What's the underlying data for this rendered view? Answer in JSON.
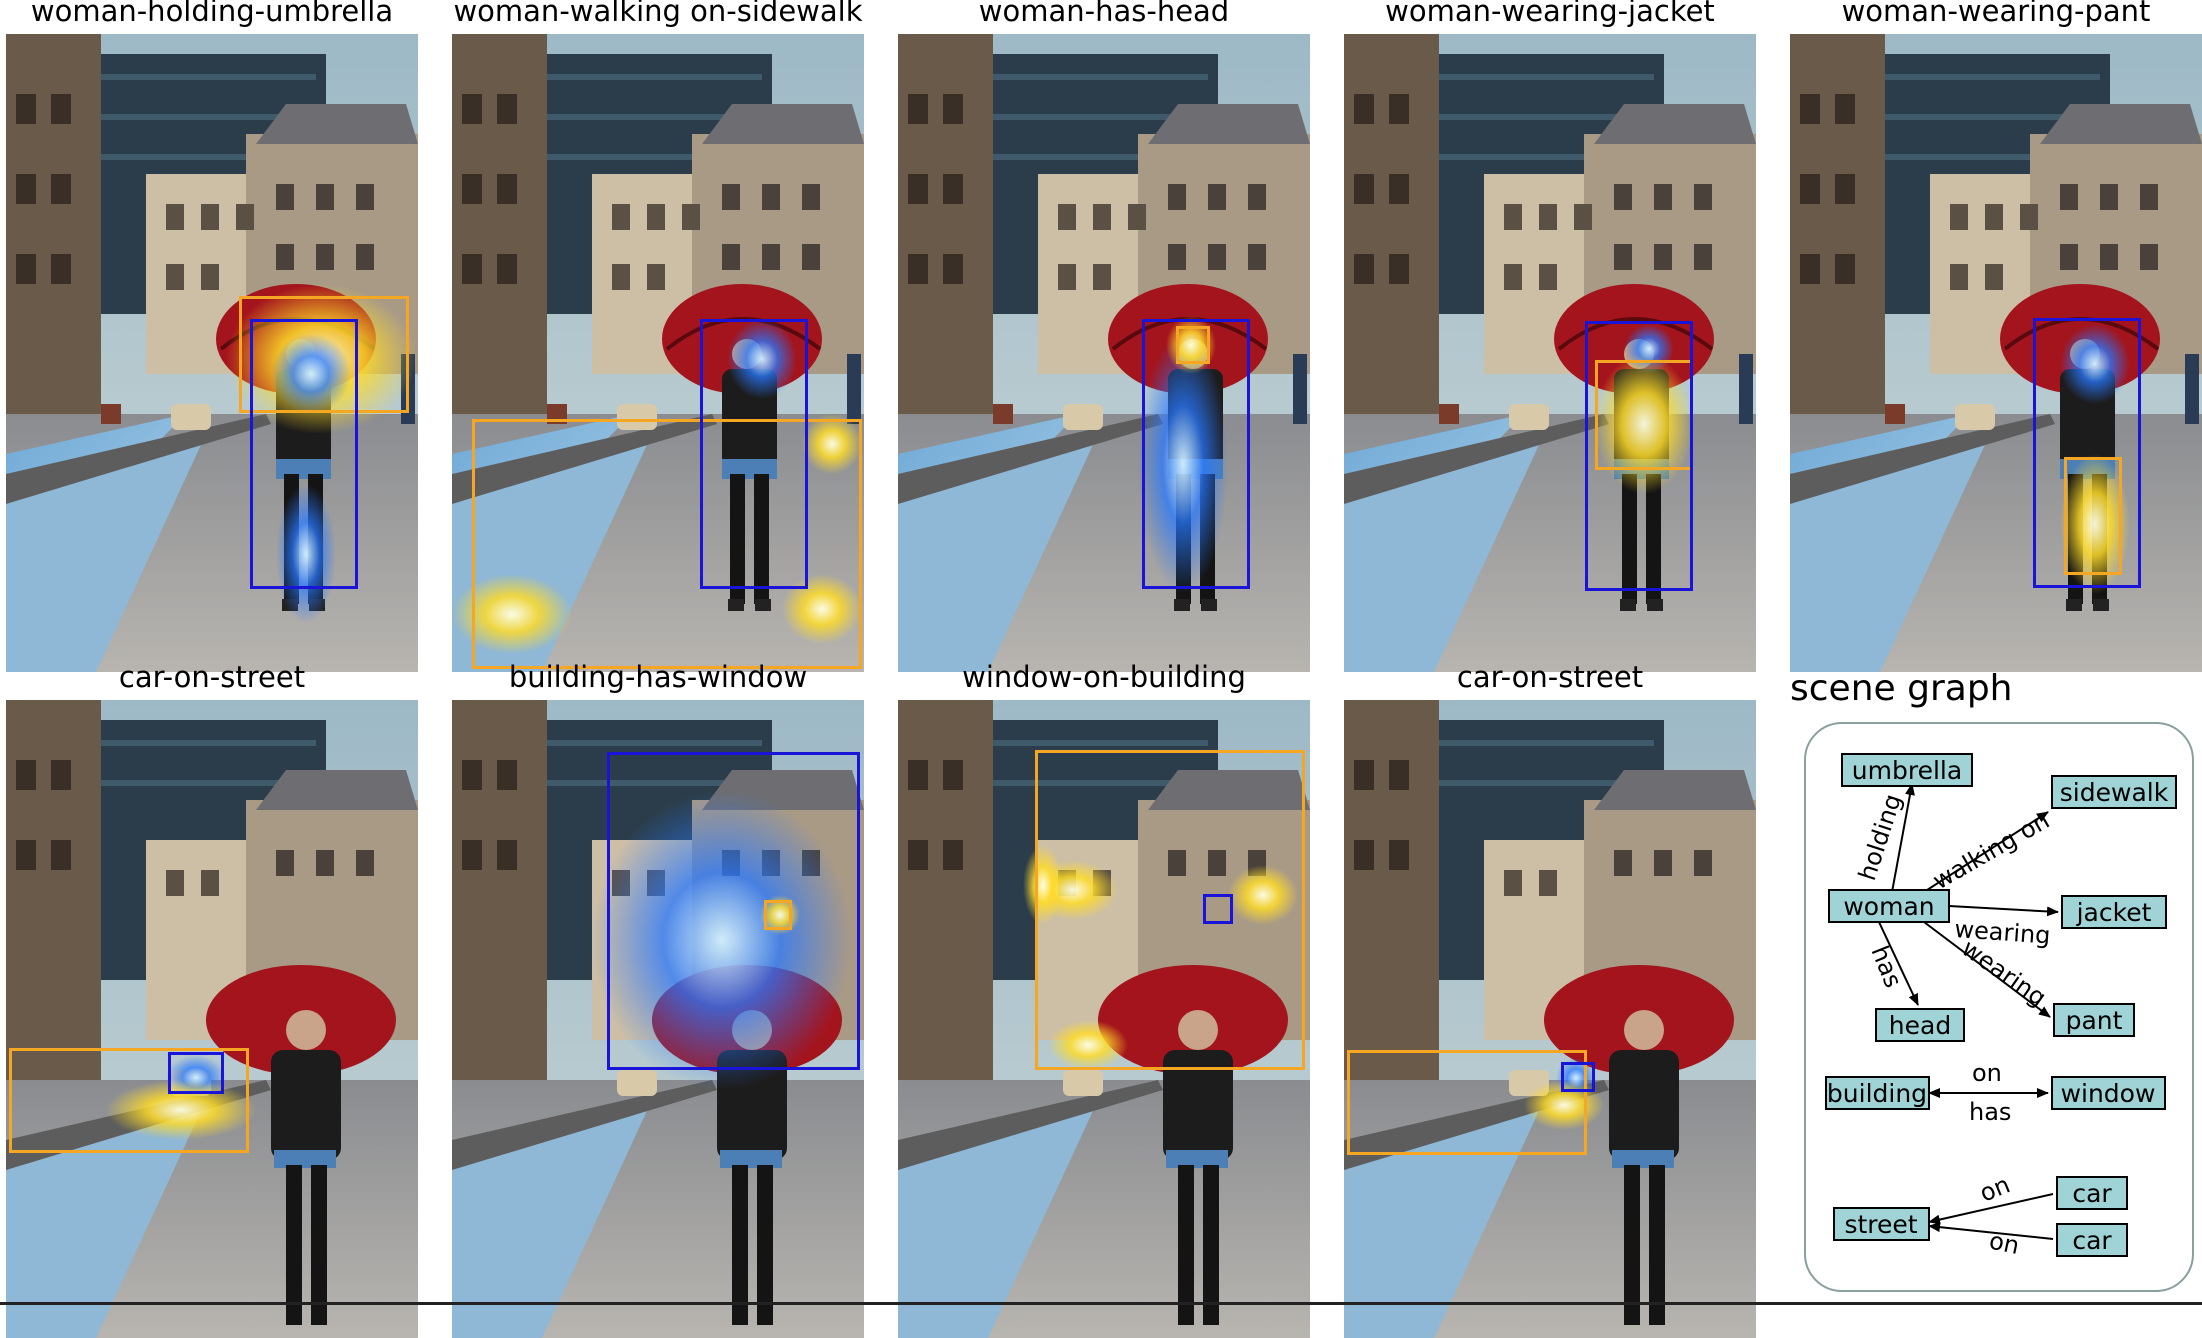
{
  "panels": [
    {
      "title": "woman-holding-umbrella"
    },
    {
      "title": "woman-walking on-sidewalk"
    },
    {
      "title": "woman-has-head"
    },
    {
      "title": "woman-wearing-jacket"
    },
    {
      "title": "woman-wearing-pant"
    },
    {
      "title": "car-on-street"
    },
    {
      "title": "building-has-window"
    },
    {
      "title": "window-on-building"
    },
    {
      "title": "car-on-street"
    }
  ],
  "scene_graph": {
    "title": "scene graph",
    "nodes": {
      "umbrella": "umbrella",
      "sidewalk": "sidewalk",
      "woman": "woman",
      "jacket": "jacket",
      "head": "head",
      "pant": "pant",
      "building": "building",
      "window": "window",
      "street": "street",
      "car1": "car",
      "car2": "car"
    },
    "edges": {
      "holding": "holding",
      "walking_on": "walking on",
      "wearing_jacket": "wearing",
      "wearing_pant": "wearing",
      "has_head": "has",
      "on_window": "on",
      "has_building": "has",
      "on_car1": "on",
      "on_car2": "on"
    }
  },
  "colors": {
    "subject_box": "#1a14d8",
    "object_box": "#f5a623",
    "node_fill": "#9fd3d6",
    "frame": "#8aa0a0"
  }
}
